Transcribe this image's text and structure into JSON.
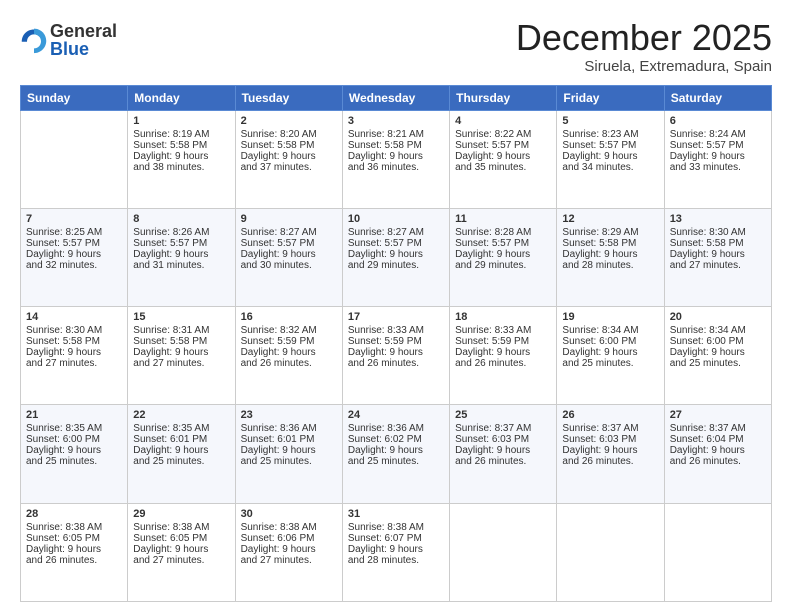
{
  "header": {
    "logo_general": "General",
    "logo_blue": "Blue",
    "month_year": "December 2025",
    "location": "Siruela, Extremadura, Spain"
  },
  "weekdays": [
    "Sunday",
    "Monday",
    "Tuesday",
    "Wednesday",
    "Thursday",
    "Friday",
    "Saturday"
  ],
  "weeks": [
    [
      {
        "day": "",
        "content": ""
      },
      {
        "day": "1",
        "content": "Sunrise: 8:19 AM\nSunset: 5:58 PM\nDaylight: 9 hours\nand 38 minutes."
      },
      {
        "day": "2",
        "content": "Sunrise: 8:20 AM\nSunset: 5:58 PM\nDaylight: 9 hours\nand 37 minutes."
      },
      {
        "day": "3",
        "content": "Sunrise: 8:21 AM\nSunset: 5:58 PM\nDaylight: 9 hours\nand 36 minutes."
      },
      {
        "day": "4",
        "content": "Sunrise: 8:22 AM\nSunset: 5:57 PM\nDaylight: 9 hours\nand 35 minutes."
      },
      {
        "day": "5",
        "content": "Sunrise: 8:23 AM\nSunset: 5:57 PM\nDaylight: 9 hours\nand 34 minutes."
      },
      {
        "day": "6",
        "content": "Sunrise: 8:24 AM\nSunset: 5:57 PM\nDaylight: 9 hours\nand 33 minutes."
      }
    ],
    [
      {
        "day": "7",
        "content": "Sunrise: 8:25 AM\nSunset: 5:57 PM\nDaylight: 9 hours\nand 32 minutes."
      },
      {
        "day": "8",
        "content": "Sunrise: 8:26 AM\nSunset: 5:57 PM\nDaylight: 9 hours\nand 31 minutes."
      },
      {
        "day": "9",
        "content": "Sunrise: 8:27 AM\nSunset: 5:57 PM\nDaylight: 9 hours\nand 30 minutes."
      },
      {
        "day": "10",
        "content": "Sunrise: 8:27 AM\nSunset: 5:57 PM\nDaylight: 9 hours\nand 29 minutes."
      },
      {
        "day": "11",
        "content": "Sunrise: 8:28 AM\nSunset: 5:57 PM\nDaylight: 9 hours\nand 29 minutes."
      },
      {
        "day": "12",
        "content": "Sunrise: 8:29 AM\nSunset: 5:58 PM\nDaylight: 9 hours\nand 28 minutes."
      },
      {
        "day": "13",
        "content": "Sunrise: 8:30 AM\nSunset: 5:58 PM\nDaylight: 9 hours\nand 27 minutes."
      }
    ],
    [
      {
        "day": "14",
        "content": "Sunrise: 8:30 AM\nSunset: 5:58 PM\nDaylight: 9 hours\nand 27 minutes."
      },
      {
        "day": "15",
        "content": "Sunrise: 8:31 AM\nSunset: 5:58 PM\nDaylight: 9 hours\nand 27 minutes."
      },
      {
        "day": "16",
        "content": "Sunrise: 8:32 AM\nSunset: 5:59 PM\nDaylight: 9 hours\nand 26 minutes."
      },
      {
        "day": "17",
        "content": "Sunrise: 8:33 AM\nSunset: 5:59 PM\nDaylight: 9 hours\nand 26 minutes."
      },
      {
        "day": "18",
        "content": "Sunrise: 8:33 AM\nSunset: 5:59 PM\nDaylight: 9 hours\nand 26 minutes."
      },
      {
        "day": "19",
        "content": "Sunrise: 8:34 AM\nSunset: 6:00 PM\nDaylight: 9 hours\nand 25 minutes."
      },
      {
        "day": "20",
        "content": "Sunrise: 8:34 AM\nSunset: 6:00 PM\nDaylight: 9 hours\nand 25 minutes."
      }
    ],
    [
      {
        "day": "21",
        "content": "Sunrise: 8:35 AM\nSunset: 6:00 PM\nDaylight: 9 hours\nand 25 minutes."
      },
      {
        "day": "22",
        "content": "Sunrise: 8:35 AM\nSunset: 6:01 PM\nDaylight: 9 hours\nand 25 minutes."
      },
      {
        "day": "23",
        "content": "Sunrise: 8:36 AM\nSunset: 6:01 PM\nDaylight: 9 hours\nand 25 minutes."
      },
      {
        "day": "24",
        "content": "Sunrise: 8:36 AM\nSunset: 6:02 PM\nDaylight: 9 hours\nand 25 minutes."
      },
      {
        "day": "25",
        "content": "Sunrise: 8:37 AM\nSunset: 6:03 PM\nDaylight: 9 hours\nand 26 minutes."
      },
      {
        "day": "26",
        "content": "Sunrise: 8:37 AM\nSunset: 6:03 PM\nDaylight: 9 hours\nand 26 minutes."
      },
      {
        "day": "27",
        "content": "Sunrise: 8:37 AM\nSunset: 6:04 PM\nDaylight: 9 hours\nand 26 minutes."
      }
    ],
    [
      {
        "day": "28",
        "content": "Sunrise: 8:38 AM\nSunset: 6:05 PM\nDaylight: 9 hours\nand 26 minutes."
      },
      {
        "day": "29",
        "content": "Sunrise: 8:38 AM\nSunset: 6:05 PM\nDaylight: 9 hours\nand 27 minutes."
      },
      {
        "day": "30",
        "content": "Sunrise: 8:38 AM\nSunset: 6:06 PM\nDaylight: 9 hours\nand 27 minutes."
      },
      {
        "day": "31",
        "content": "Sunrise: 8:38 AM\nSunset: 6:07 PM\nDaylight: 9 hours\nand 28 minutes."
      },
      {
        "day": "",
        "content": ""
      },
      {
        "day": "",
        "content": ""
      },
      {
        "day": "",
        "content": ""
      }
    ]
  ]
}
